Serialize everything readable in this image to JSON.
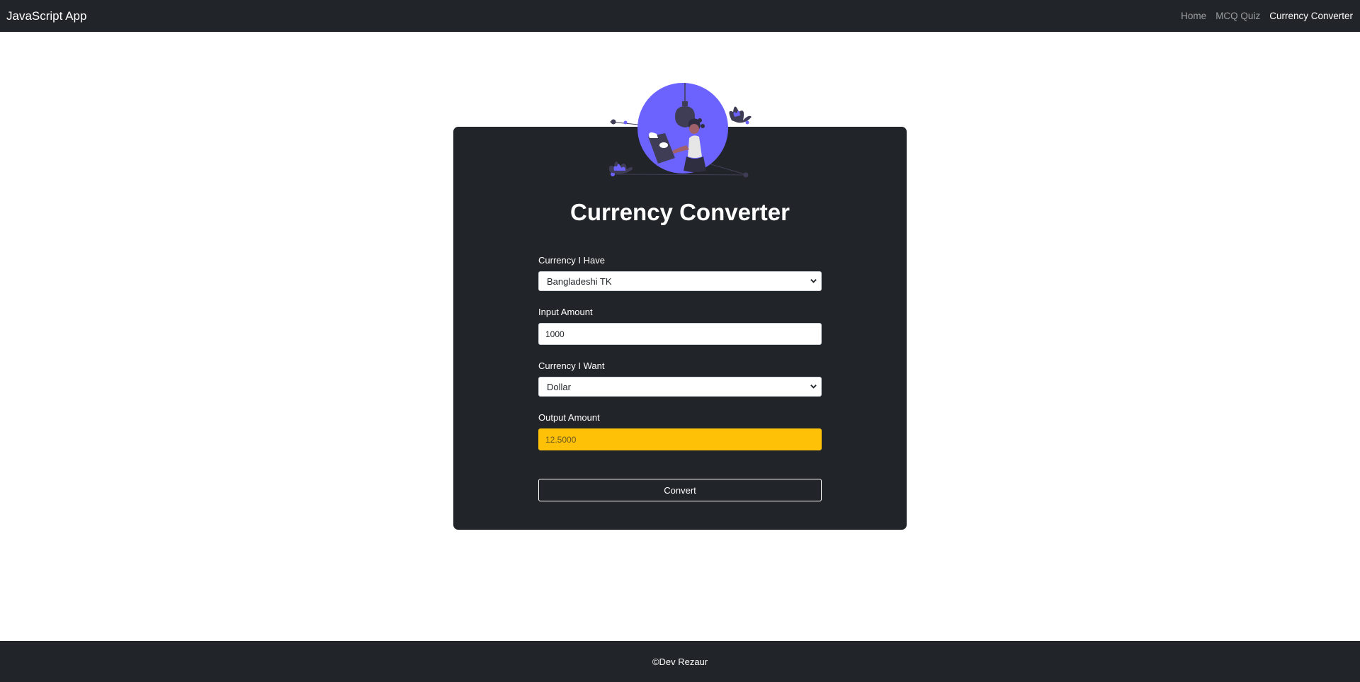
{
  "navbar": {
    "brand": "JavaScript App",
    "links": [
      {
        "label": "Home",
        "active": false
      },
      {
        "label": "MCQ Quiz",
        "active": false
      },
      {
        "label": "Currency Converter",
        "active": true
      }
    ]
  },
  "converter": {
    "title": "Currency Converter",
    "currency_have": {
      "label": "Currency I Have",
      "selected": "Bangladeshi TK"
    },
    "input_amount": {
      "label": "Input Amount",
      "value": "1000"
    },
    "currency_want": {
      "label": "Currency I Want",
      "selected": "Dollar"
    },
    "output_amount": {
      "label": "Output Amount",
      "value": "12.5000"
    },
    "convert_label": "Convert"
  },
  "footer": {
    "text": "©Dev Rezaur"
  },
  "colors": {
    "dark": "#212529",
    "accent": "#6c63ff",
    "output_bg": "#ffc107",
    "white": "#ffffff"
  },
  "icons": {
    "select_arrow": "chevron-down-icon",
    "illustration": "reading-woman-lightbulb-illustration"
  }
}
